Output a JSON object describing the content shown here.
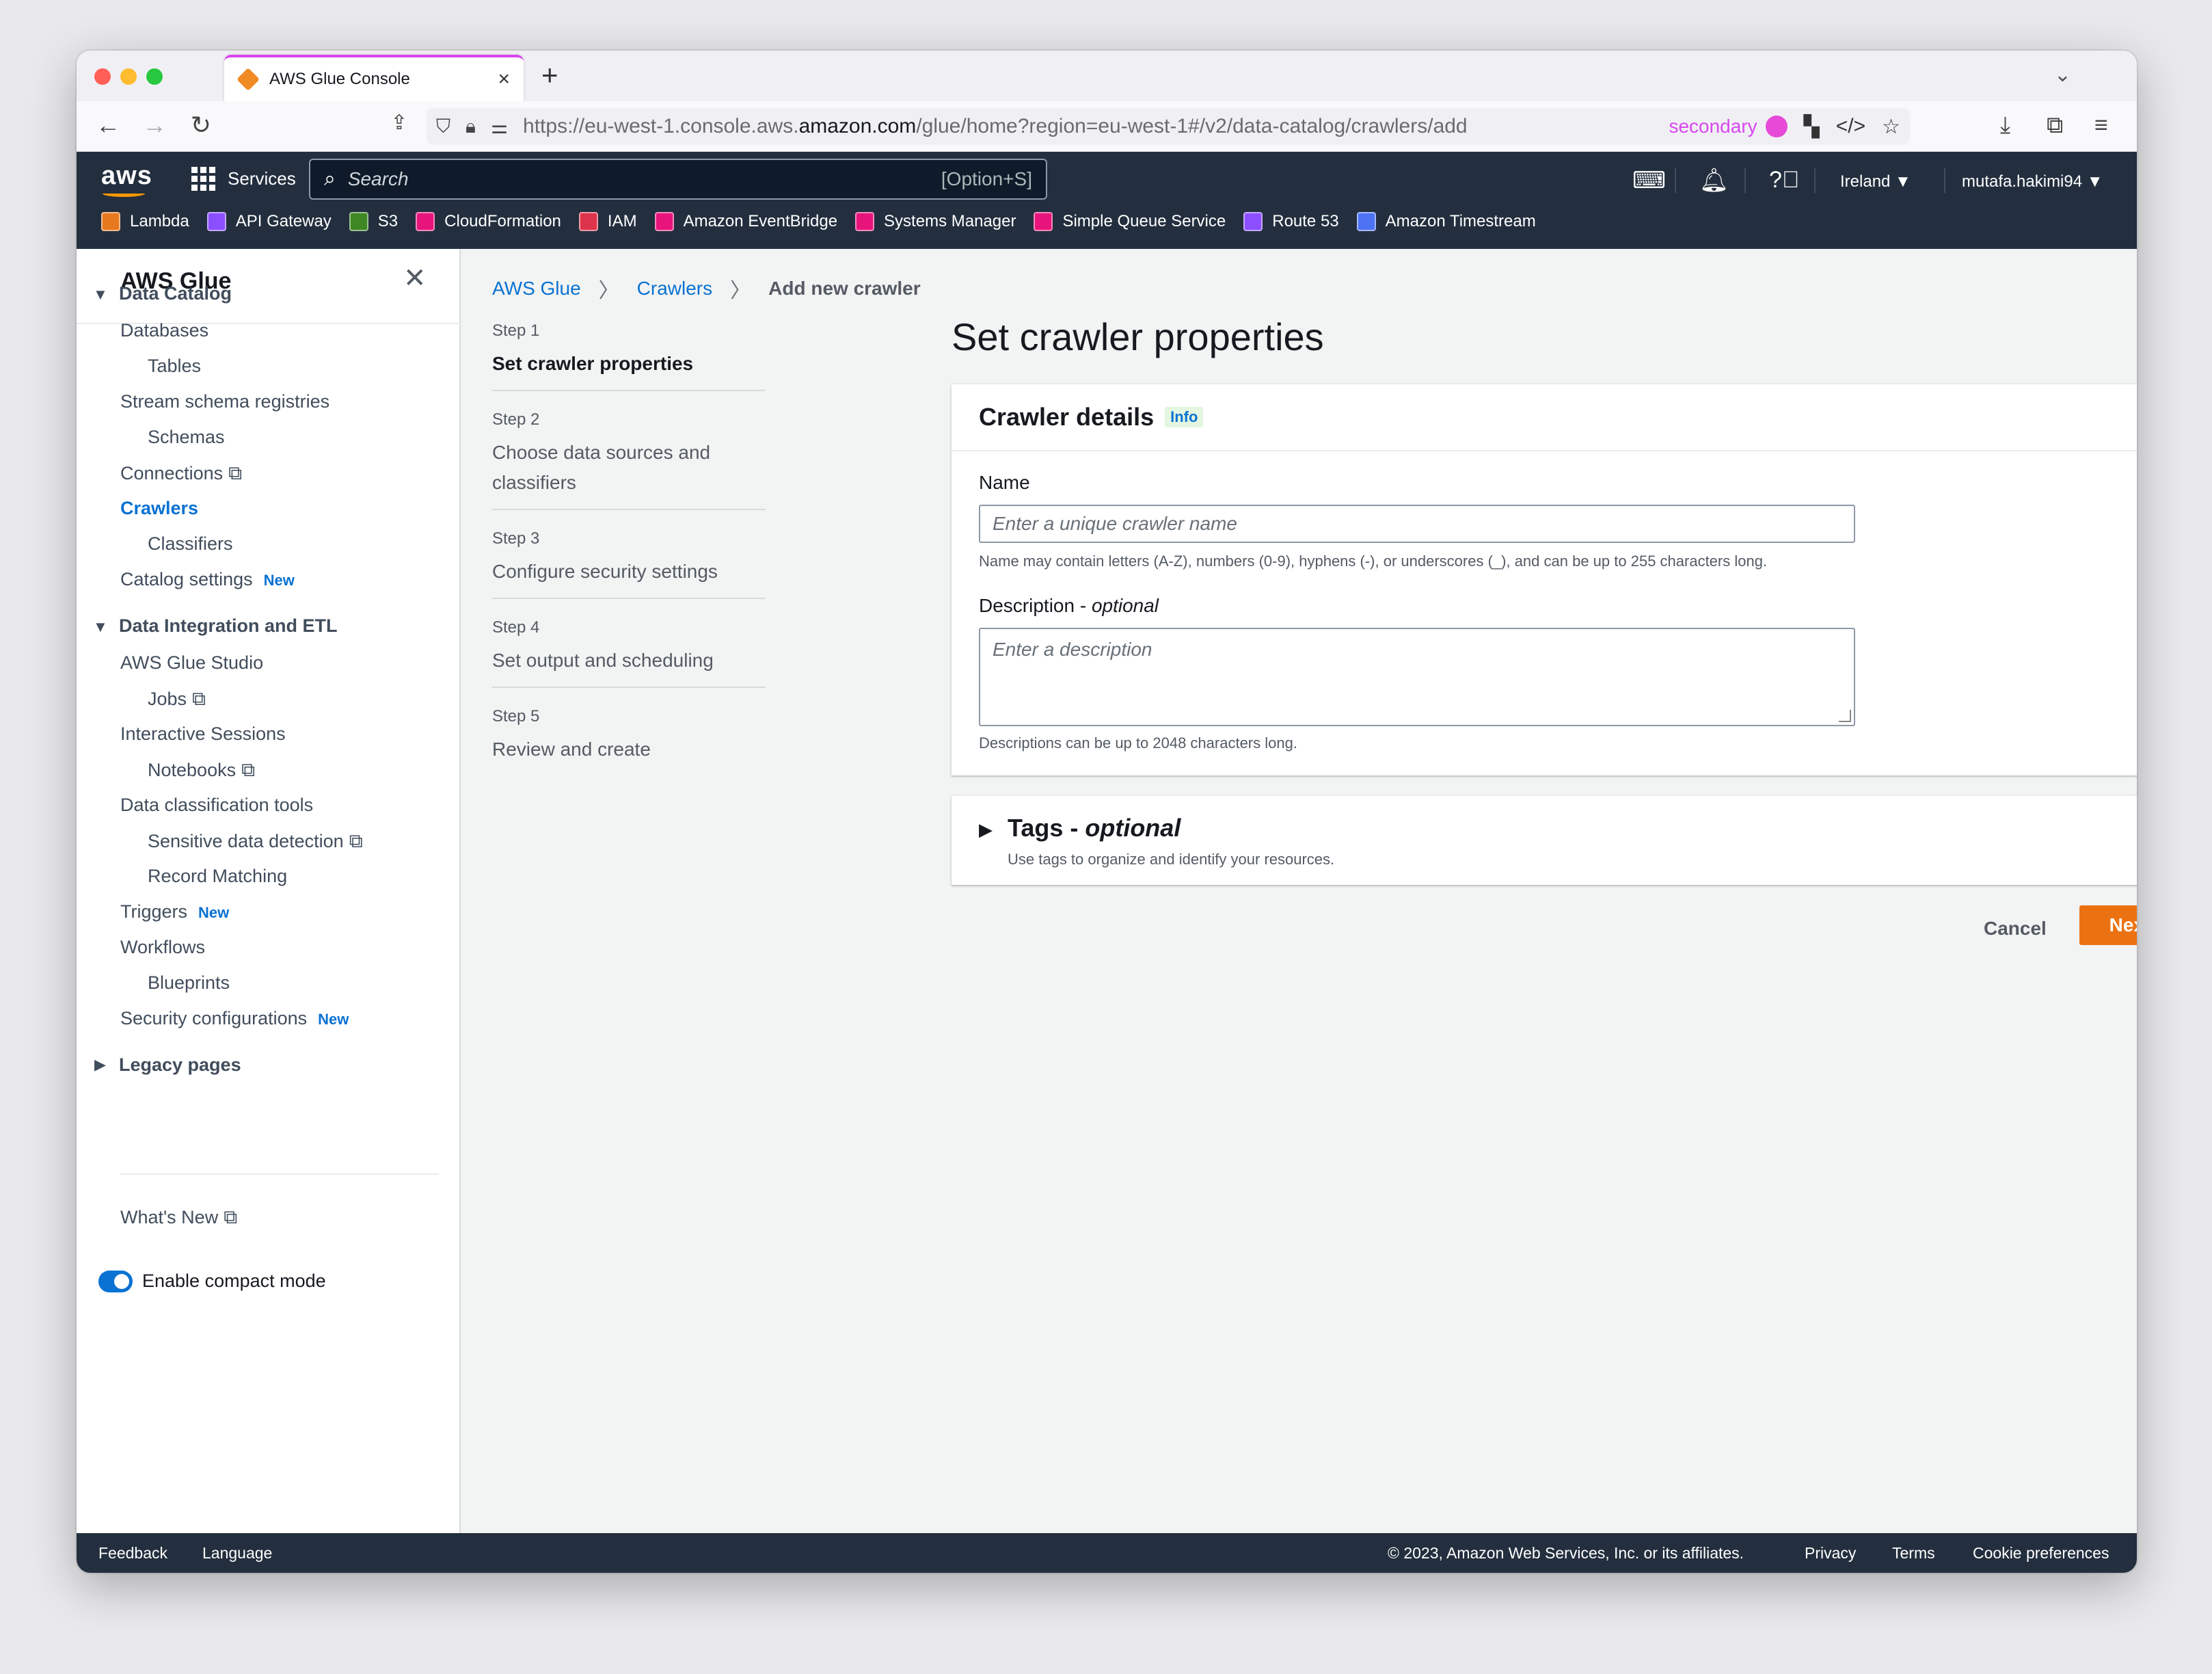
{
  "browser": {
    "tab_title": "AWS Glue Console",
    "new_tab": "+",
    "url_prefix": "https://eu-west-1.console.aws.",
    "url_domain": "amazon.com",
    "url_suffix": "/glue/home?region=eu-west-1#/v2/data-catalog/crawlers/add",
    "container": "secondary",
    "container_color": "#e64ad6"
  },
  "header": {
    "logo": "aws",
    "services": "Services",
    "search_placeholder": "Search",
    "search_shortcut": "[Option+S]",
    "region": "Ireland ▼",
    "account": "mutafa.hakimi94 ▼",
    "favorites": [
      {
        "label": "Lambda",
        "color": "#e8781e"
      },
      {
        "label": "API Gateway",
        "color": "#8c4fff"
      },
      {
        "label": "S3",
        "color": "#3f8624"
      },
      {
        "label": "CloudFormation",
        "color": "#e7157b"
      },
      {
        "label": "IAM",
        "color": "#dd344c"
      },
      {
        "label": "Amazon EventBridge",
        "color": "#e7157b"
      },
      {
        "label": "Systems Manager",
        "color": "#e7157b"
      },
      {
        "label": "Simple Queue Service",
        "color": "#e7157b"
      },
      {
        "label": "Route 53",
        "color": "#8c4fff"
      },
      {
        "label": "Amazon Timestream",
        "color": "#4d72f3"
      }
    ]
  },
  "sidenav": {
    "title": "AWS Glue",
    "sec_data_catalog": "Data Catalog",
    "databases": "Databases",
    "tables": "Tables",
    "stream_schema": "Stream schema registries",
    "schemas": "Schemas",
    "connections": "Connections",
    "crawlers": "Crawlers",
    "classifiers": "Classifiers",
    "catalog_settings": "Catalog settings",
    "new_badge": "New",
    "sec_integration": "Data Integration and ETL",
    "glue_studio": "AWS Glue Studio",
    "jobs": "Jobs",
    "interactive": "Interactive Sessions",
    "notebooks": "Notebooks",
    "classification": "Data classification tools",
    "sensitive": "Sensitive data detection",
    "record_matching": "Record Matching",
    "triggers": "Triggers",
    "workflows": "Workflows",
    "blueprints": "Blueprints",
    "security_config": "Security configurations",
    "legacy": "Legacy pages",
    "whats_new": "What's New",
    "compact_mode": "Enable compact mode"
  },
  "breadcrumb": [
    "AWS Glue",
    "Crawlers",
    "Add new crawler"
  ],
  "wizard": [
    {
      "label": "Step 1",
      "title": "Set crawler properties"
    },
    {
      "label": "Step 2",
      "title": "Choose data sources and classifiers"
    },
    {
      "label": "Step 3",
      "title": "Configure security settings"
    },
    {
      "label": "Step 4",
      "title": "Set output and scheduling"
    },
    {
      "label": "Step 5",
      "title": "Review and create"
    }
  ],
  "main": {
    "title": "Set crawler properties",
    "panel_title": "Crawler details",
    "info": "Info",
    "name_label": "Name",
    "name_placeholder": "Enter a unique crawler name",
    "name_hint": "Name may contain letters (A-Z), numbers (0-9), hyphens (-), or underscores (_), and can be up to 255 characters long.",
    "desc_label": "Description - ",
    "desc_optional": "optional",
    "desc_placeholder": "Enter a description",
    "desc_hint": "Descriptions can be up to 2048 characters long.",
    "tags_title": "Tags - ",
    "tags_optional": "optional",
    "tags_sub": "Use tags to organize and identify your resources.",
    "cancel": "Cancel",
    "next": "Next",
    "accent": "#ec7211"
  },
  "footer": {
    "feedback": "Feedback",
    "language": "Language",
    "copyright": "© 2023, Amazon Web Services, Inc. or its affiliates.",
    "privacy": "Privacy",
    "terms": "Terms",
    "cookies": "Cookie preferences"
  }
}
